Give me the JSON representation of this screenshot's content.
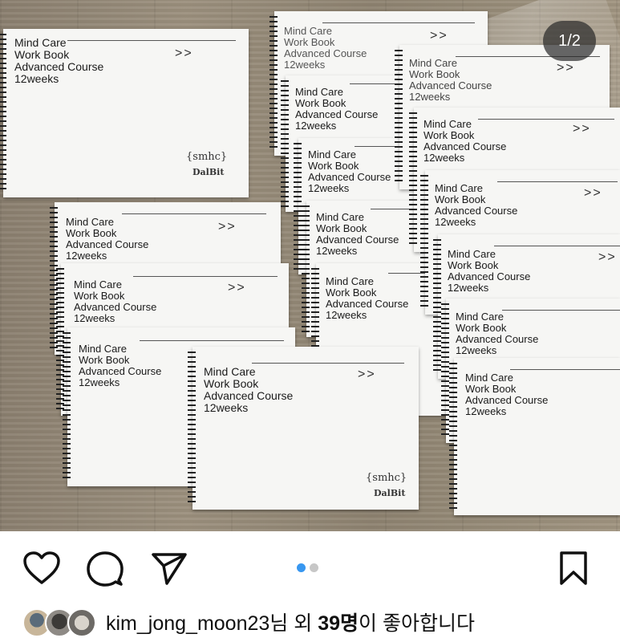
{
  "photo": {
    "counter": "1/2",
    "notebook": {
      "line1": "Mind Care",
      "line2": "Work Book",
      "line3": "Advanced Course",
      "line4": "12weeks",
      "arrow": ">>",
      "logo": "{smhc}",
      "brand": "DalBit"
    }
  },
  "actions": {
    "like_icon": "heart-icon",
    "comment_icon": "comment-icon",
    "share_icon": "send-icon",
    "save_icon": "bookmark-icon",
    "carousel_total": 2,
    "carousel_active": 1,
    "active_dot_color": "#3897f0",
    "inactive_dot_color": "#c7c7c7"
  },
  "likes": {
    "username": "kim_jong_moon23",
    "mid": "님 외 ",
    "count": "39명",
    "suffix": "이 좋아합니다"
  }
}
